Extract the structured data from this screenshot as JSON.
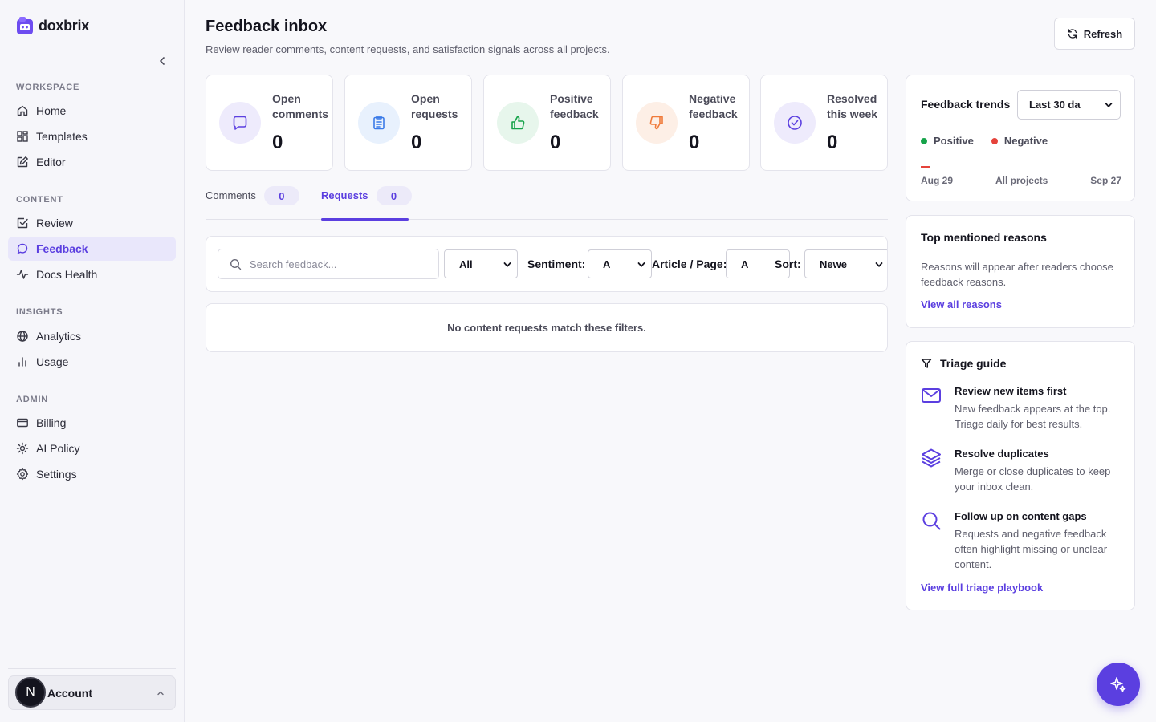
{
  "brand": {
    "name": "doxbrix",
    "accent": "#5b3fe0"
  },
  "sidebar": {
    "sections": [
      {
        "heading": "WORKSPACE",
        "items": [
          {
            "label": "Home",
            "icon": "home-icon"
          },
          {
            "label": "Templates",
            "icon": "grid-icon"
          },
          {
            "label": "Editor",
            "icon": "edit-icon"
          }
        ]
      },
      {
        "heading": "CONTENT",
        "items": [
          {
            "label": "Review",
            "icon": "check-square-icon"
          },
          {
            "label": "Feedback",
            "icon": "message-icon",
            "active": true
          },
          {
            "label": "Docs Health",
            "icon": "activity-icon"
          }
        ]
      },
      {
        "heading": "INSIGHTS",
        "items": [
          {
            "label": "Analytics",
            "icon": "globe-icon"
          },
          {
            "label": "Usage",
            "icon": "bar-chart-icon"
          }
        ]
      },
      {
        "heading": "ADMIN",
        "items": [
          {
            "label": "Billing",
            "icon": "credit-card-icon"
          },
          {
            "label": "AI Policy",
            "icon": "sun-icon"
          },
          {
            "label": "Settings",
            "icon": "gear-icon"
          }
        ]
      }
    ],
    "account": {
      "initial": "N",
      "label": "Account"
    }
  },
  "header": {
    "title": "Feedback inbox",
    "subtitle": "Review reader comments, content requests, and satisfaction signals across all projects.",
    "refresh_label": "Refresh"
  },
  "stats": [
    {
      "label": "Open comments",
      "value": "0",
      "icon": "message-icon",
      "color": "#5b3fe0",
      "bg": "#eeebfc"
    },
    {
      "label": "Open requests",
      "value": "0",
      "icon": "clipboard-icon",
      "color": "#3b7be8",
      "bg": "#e8f1fd"
    },
    {
      "label": "Positive feedback",
      "value": "0",
      "icon": "thumbs-up-icon",
      "color": "#16a34a",
      "bg": "#e7f6ec"
    },
    {
      "label": "Negative feedback",
      "value": "0",
      "icon": "thumbs-down-icon",
      "color": "#f07a3a",
      "bg": "#fdefe6"
    },
    {
      "label": "Resolved this week",
      "value": "0",
      "icon": "check-circle-icon",
      "color": "#5b3fe0",
      "bg": "#eeebfc"
    }
  ],
  "tabs": [
    {
      "label": "Comments",
      "count": "0"
    },
    {
      "label": "Requests",
      "count": "0",
      "active": true
    }
  ],
  "filters": {
    "search_placeholder": "Search feedback...",
    "type_value": "All",
    "sentiment_label": "Sentiment:",
    "sentiment_value": "A",
    "article_label": "Article / Page:",
    "article_value": "A",
    "sort_label": "Sort:",
    "sort_value": "Newe"
  },
  "empty_message": "No content requests match these filters.",
  "trends": {
    "title": "Feedback trends",
    "range_value": "Last 30 da",
    "legend": [
      {
        "label": "Positive",
        "color": "#16a34a"
      },
      {
        "label": "Negative",
        "color": "#e5433b"
      }
    ],
    "axis": {
      "start": "Aug 29",
      "middle": "All projects",
      "end": "Sep 27"
    }
  },
  "reasons": {
    "title": "Top mentioned reasons",
    "text": "Reasons will appear after readers choose feedback reasons.",
    "link": "View all reasons"
  },
  "triage": {
    "title": "Triage guide",
    "items": [
      {
        "title": "Review new items first",
        "desc": "New feedback appears at the top. Triage daily for best results.",
        "icon": "mail-icon"
      },
      {
        "title": "Resolve duplicates",
        "desc": "Merge or close duplicates to keep your inbox clean.",
        "icon": "layers-icon"
      },
      {
        "title": "Follow up on content gaps",
        "desc": "Requests and negative feedback often highlight missing or unclear content.",
        "icon": "search-icon"
      }
    ],
    "link": "View full triage playbook"
  }
}
